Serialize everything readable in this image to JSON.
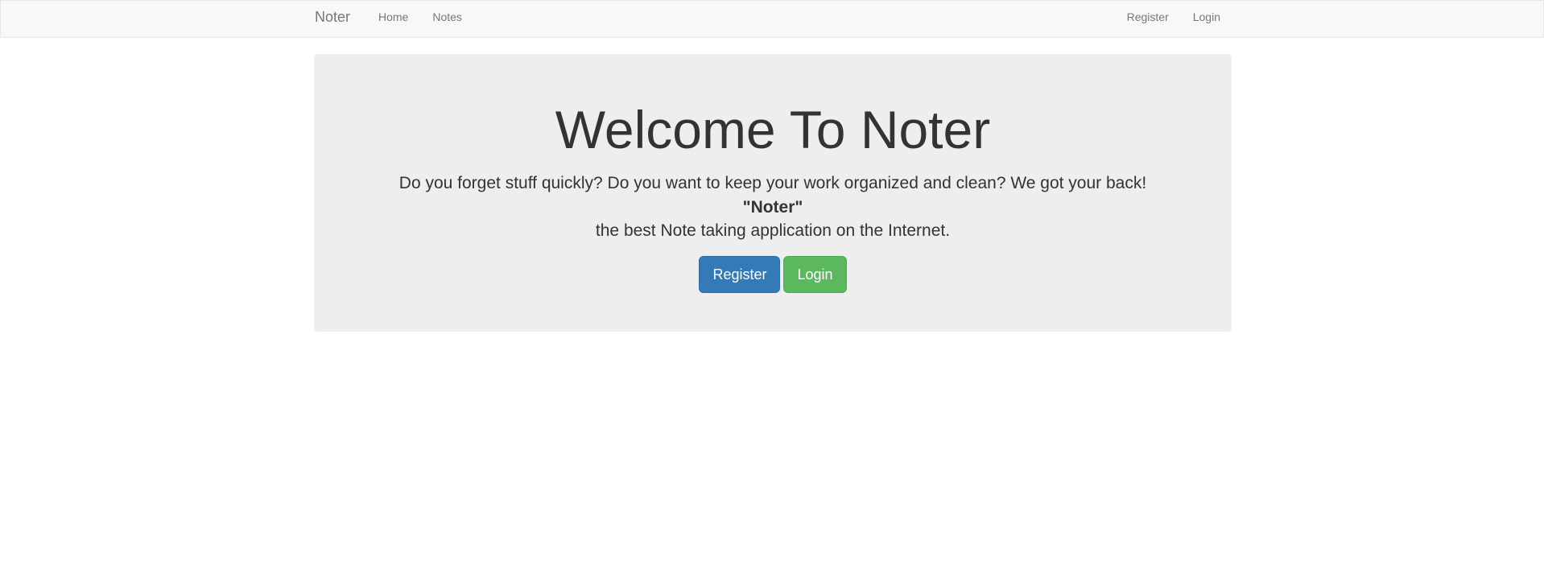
{
  "navbar": {
    "brand": "Noter",
    "left_links": [
      "Home",
      "Notes"
    ],
    "right_links": [
      "Register",
      "Login"
    ]
  },
  "jumbotron": {
    "title": "Welcome To Noter",
    "line1": "Do you forget stuff quickly? Do you want to keep your work organized and clean? We got your back!",
    "brand_quote": "\"Noter\"",
    "line3": "the best Note taking application on the Internet.",
    "register_button": "Register",
    "login_button": "Login"
  },
  "colors": {
    "navbar_bg": "#f8f8f8",
    "jumbotron_bg": "#eeeeee",
    "primary": "#337ab7",
    "success": "#5cb85c"
  }
}
